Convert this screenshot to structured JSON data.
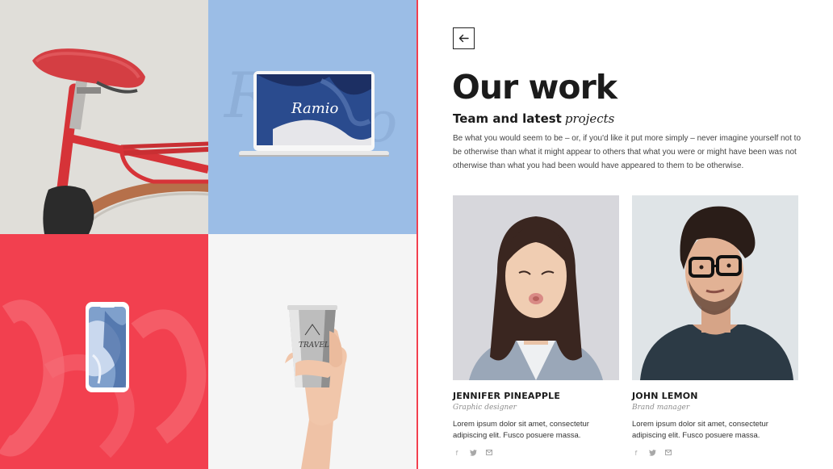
{
  "colors": {
    "accent_red": "#f2404f",
    "sky_blue": "#9bbde6",
    "heading": "#1b1b1b"
  },
  "mosaic": {
    "tiles": [
      {
        "name": "bicycle-photo"
      },
      {
        "name": "laptop-mockup",
        "screen_text": "Ramio"
      },
      {
        "name": "phone-mockup"
      },
      {
        "name": "travel-cup-photo",
        "cup_text": "TRAVEL"
      }
    ]
  },
  "header": {
    "back_icon": "arrow-left-icon",
    "title": "Our work",
    "subtitle_main": "Team and latest",
    "subtitle_accent": "projects",
    "intro": "Be what you would seem to be – or, if you'd like it put more simply – never imagine yourself not to be otherwise than what it might appear to others that what you were or might have been was not otherwise than what you had been would have appeared to them to be otherwise."
  },
  "team": [
    {
      "name": "JENNIFER PINEAPPLE",
      "role": "Graphic designer",
      "bio": "Lorem ipsum dolor sit amet, consectetur adipiscing elit. Fusco posuere massa.",
      "socials": [
        "f",
        "twitter-icon",
        "email-icon"
      ]
    },
    {
      "name": "JOHN LEMON",
      "role": "Brand manager",
      "bio": "Lorem ipsum dolor sit amet, consectetur adipiscing elit. Fusco posuere massa.",
      "socials": [
        "f",
        "twitter-icon",
        "email-icon"
      ]
    }
  ]
}
